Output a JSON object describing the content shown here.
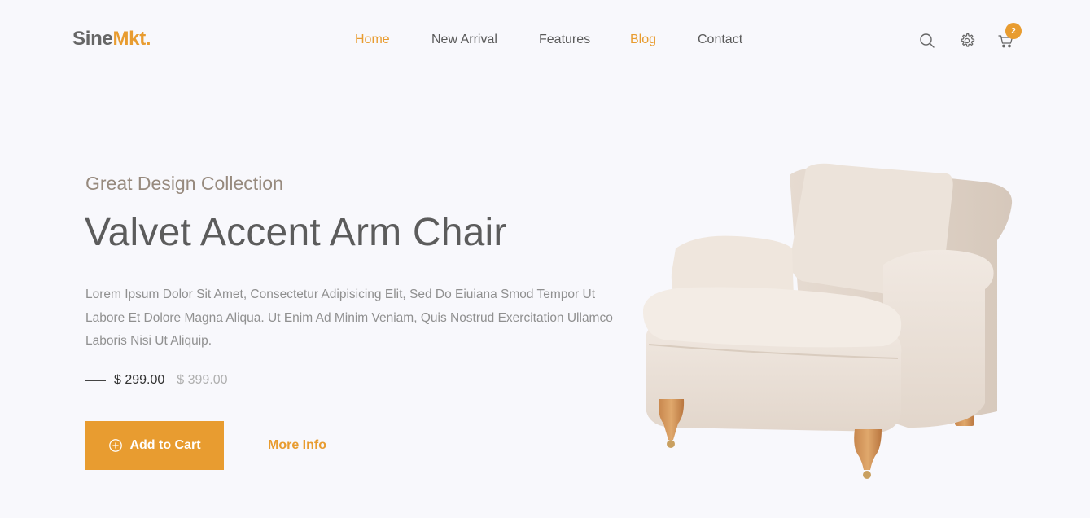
{
  "header": {
    "logo_main": "Sine",
    "logo_accent": "Mkt",
    "logo_dot": ".",
    "nav": [
      {
        "label": "Home",
        "active": true
      },
      {
        "label": "New Arrival",
        "active": false
      },
      {
        "label": "Features",
        "active": false
      },
      {
        "label": "Blog",
        "active": true
      },
      {
        "label": "Contact",
        "active": false
      }
    ],
    "icons": [
      "search-icon",
      "gear-icon",
      "cart-icon"
    ],
    "cart_count": "2"
  },
  "hero": {
    "subtitle": "Great Design Collection",
    "title": "Valvet Accent Arm Chair",
    "description": "Lorem Ipsum Dolor Sit Amet, Consectetur Adipisicing Elit, Sed Do Eiuiana Smod Tempor Ut Labore Et Dolore Magna Aliqua. Ut Enim Ad Minim Veniam, Quis Nostrud Exercitation Ullamco Laboris Nisi Ut Aliquip.",
    "price": "$ 299.00",
    "old_price": "$ 399.00",
    "add_to_cart_label": "Add to Cart",
    "more_info_label": "More Info"
  },
  "colors": {
    "accent": "#e89c30",
    "background": "#f8f8fc",
    "text": "#5c5c5c"
  }
}
